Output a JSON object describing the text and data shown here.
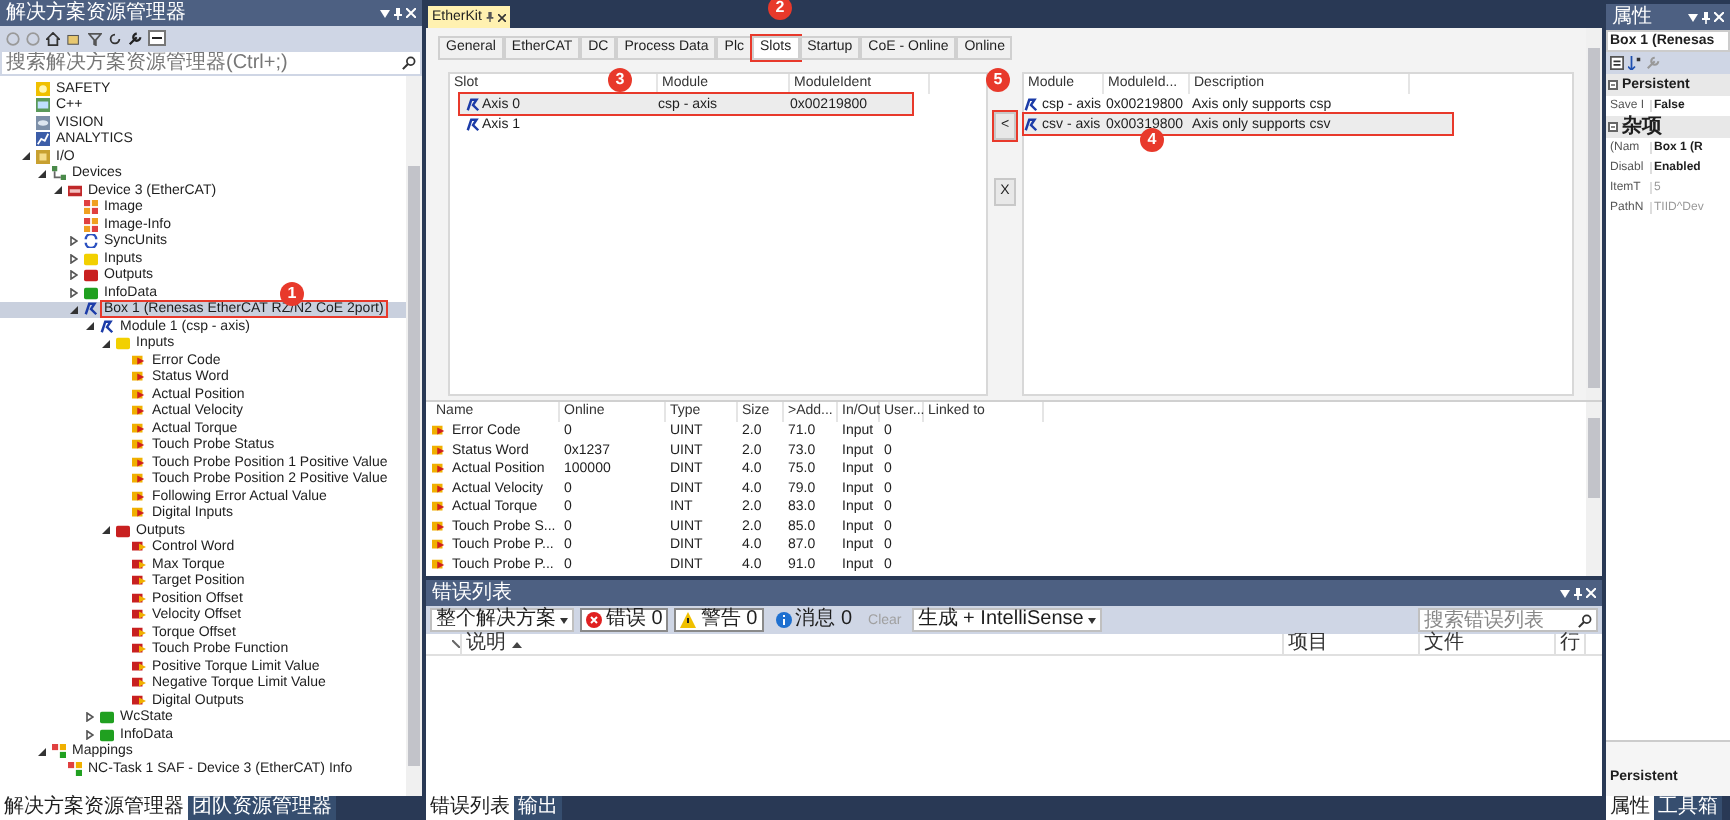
{
  "solution_explorer": {
    "title": "解决方案资源管理器",
    "search": {
      "placeholder": "搜索解决方案资源管理器(Ctrl+;)"
    },
    "tree": [
      {
        "label": "SAFETY",
        "kind": "safety",
        "selected": false
      },
      {
        "label": "C++",
        "kind": "cpp",
        "selected": false
      },
      {
        "label": "VISION",
        "kind": "vision",
        "selected": false
      },
      {
        "label": "ANALYTICS",
        "kind": "analytics",
        "selected": false
      },
      {
        "label": "I/O",
        "kind": "io",
        "selected": false,
        "expanded": true,
        "children": [
          {
            "label": "Devices",
            "kind": "devices",
            "selected": false,
            "expanded": true,
            "children": [
              {
                "label": "Device 3 (EtherCAT)",
                "kind": "device",
                "selected": false,
                "expanded": true,
                "children": [
                  {
                    "label": "Image",
                    "kind": "image",
                    "selected": false
                  },
                  {
                    "label": "Image-Info",
                    "kind": "image",
                    "selected": false
                  },
                  {
                    "label": "SyncUnits",
                    "kind": "sync",
                    "selected": false,
                    "expanded": false
                  },
                  {
                    "label": "Inputs",
                    "kind": "inputs",
                    "selected": false,
                    "expanded": false
                  },
                  {
                    "label": "Outputs",
                    "kind": "outputs",
                    "selected": false,
                    "expanded": false
                  },
                  {
                    "label": "InfoData",
                    "kind": "infodata",
                    "selected": false,
                    "expanded": false
                  },
                  {
                    "label": "Box 1 (Renesas EtherCAT RZ/N2 CoE 2port)",
                    "kind": "box",
                    "selected": true,
                    "expanded": true,
                    "callout": "1",
                    "children": [
                      {
                        "label": "Module 1 (csp - axis)",
                        "kind": "box",
                        "selected": false,
                        "expanded": true,
                        "children": [
                          {
                            "label": "Inputs",
                            "kind": "inputs",
                            "selected": false,
                            "expanded": true,
                            "children": [
                              {
                                "label": "Error Code",
                                "kind": "input-var",
                                "selected": false
                              },
                              {
                                "label": "Status Word",
                                "kind": "input-var",
                                "selected": false
                              },
                              {
                                "label": "Actual Position",
                                "kind": "input-var",
                                "selected": false
                              },
                              {
                                "label": "Actual Velocity",
                                "kind": "input-var",
                                "selected": false
                              },
                              {
                                "label": "Actual Torque",
                                "kind": "input-var",
                                "selected": false
                              },
                              {
                                "label": "Touch Probe Status",
                                "kind": "input-var",
                                "selected": false
                              },
                              {
                                "label": "Touch Probe Position 1 Positive Value",
                                "kind": "input-var",
                                "selected": false
                              },
                              {
                                "label": "Touch Probe Position 2 Positive Value",
                                "kind": "input-var",
                                "selected": false
                              },
                              {
                                "label": "Following Error Actual Value",
                                "kind": "input-var",
                                "selected": false
                              },
                              {
                                "label": "Digital Inputs",
                                "kind": "input-var",
                                "selected": false
                              }
                            ]
                          },
                          {
                            "label": "Outputs",
                            "kind": "outputs",
                            "selected": false,
                            "expanded": true,
                            "children": [
                              {
                                "label": "Control Word",
                                "kind": "output-var",
                                "selected": false
                              },
                              {
                                "label": "Max Torque",
                                "kind": "output-var",
                                "selected": false
                              },
                              {
                                "label": "Target Position",
                                "kind": "output-var",
                                "selected": false
                              },
                              {
                                "label": "Position Offset",
                                "kind": "output-var",
                                "selected": false
                              },
                              {
                                "label": "Velocity Offset",
                                "kind": "output-var",
                                "selected": false
                              },
                              {
                                "label": "Torque Offset",
                                "kind": "output-var",
                                "selected": false
                              },
                              {
                                "label": "Touch Probe Function",
                                "kind": "output-var",
                                "selected": false
                              },
                              {
                                "label": "Positive Torque Limit Value",
                                "kind": "output-var",
                                "selected": false
                              },
                              {
                                "label": "Negative Torque Limit Value",
                                "kind": "output-var",
                                "selected": false
                              },
                              {
                                "label": "Digital Outputs",
                                "kind": "output-var",
                                "selected": false
                              }
                            ]
                          }
                        ]
                      },
                      {
                        "label": "WcState",
                        "kind": "infodata",
                        "selected": false,
                        "expanded": false
                      },
                      {
                        "label": "InfoData",
                        "kind": "infodata",
                        "selected": false,
                        "expanded": false
                      }
                    ]
                  }
                ]
              }
            ]
          },
          {
            "label": "Mappings",
            "kind": "mappings",
            "selected": false,
            "expanded": true,
            "children": [
              {
                "label": "NC-Task 1 SAF - Device 3 (EtherCAT) Info",
                "kind": "mapping",
                "selected": false
              }
            ]
          }
        ]
      }
    ],
    "bottom_tabs": [
      {
        "label": "解决方案资源管理器",
        "selected": true
      },
      {
        "label": "团队资源管理器",
        "selected": false
      }
    ]
  },
  "document": {
    "tab": {
      "label": "EtherKit"
    },
    "tabs": [
      {
        "label": "General",
        "selected": false
      },
      {
        "label": "EtherCAT",
        "selected": false
      },
      {
        "label": "DC",
        "selected": false
      },
      {
        "label": "Process Data",
        "selected": false
      },
      {
        "label": "Plc",
        "selected": false
      },
      {
        "label": "Slots",
        "selected": true,
        "callout": "2"
      },
      {
        "label": "Startup",
        "selected": false
      },
      {
        "label": "CoE - Online",
        "selected": false
      },
      {
        "label": "Online",
        "selected": false
      }
    ],
    "slots": {
      "columns": [
        "Slot",
        "Module",
        "ModuleIdent"
      ],
      "rows": [
        {
          "cells": [
            "Axis 0",
            "csp - axis",
            "0x00219800"
          ],
          "selected": true,
          "callout": "3"
        },
        {
          "cells": [
            "Axis 1"
          ],
          "selected": false
        }
      ]
    },
    "buttons": [
      {
        "label": "<",
        "callout": "5"
      },
      {
        "label": "X"
      }
    ],
    "modules": {
      "columns": [
        "Module",
        "ModuleId...",
        "Description"
      ],
      "rows": [
        {
          "cells": [
            "csp - axis",
            "0x00219800",
            "Axis only supports csp"
          ],
          "selected": false
        },
        {
          "cells": [
            "csv - axis",
            "0x00319800",
            "Axis only supports csv"
          ],
          "selected": true,
          "callout": "4"
        }
      ]
    },
    "variables": {
      "columns": [
        "Name",
        "Online",
        "Type",
        "Size",
        ">Add...",
        "In/Out",
        "User...",
        "Linked to"
      ],
      "rows": [
        [
          "Error Code",
          "0",
          "UINT",
          "2.0",
          "71.0",
          "Input",
          "0"
        ],
        [
          "Status Word",
          "0x1237",
          "UINT",
          "2.0",
          "73.0",
          "Input",
          "0"
        ],
        [
          "Actual Position",
          "100000",
          "DINT",
          "4.0",
          "75.0",
          "Input",
          "0"
        ],
        [
          "Actual Velocity",
          "0",
          "DINT",
          "4.0",
          "79.0",
          "Input",
          "0"
        ],
        [
          "Actual Torque",
          "0",
          "INT",
          "2.0",
          "83.0",
          "Input",
          "0"
        ],
        [
          "Touch Probe S...",
          "0",
          "UINT",
          "2.0",
          "85.0",
          "Input",
          "0"
        ],
        [
          "Touch Probe P...",
          "0",
          "DINT",
          "4.0",
          "87.0",
          "Input",
          "0"
        ],
        [
          "Touch Probe P...",
          "0",
          "DINT",
          "4.0",
          "91.0",
          "Input",
          "0"
        ]
      ]
    }
  },
  "error_list": {
    "title": "错误列表",
    "scope": "整个解决方案",
    "filters": [
      {
        "kind": "error",
        "label": "错误 0",
        "on": true
      },
      {
        "kind": "warning",
        "label": "警告 0",
        "on": true
      },
      {
        "kind": "message",
        "label": "消息 0",
        "on": false
      }
    ],
    "clear": {
      "label": "Clear",
      "disabled": true
    },
    "source": "生成 + IntelliSense",
    "search": {
      "placeholder": "搜索错误列表"
    },
    "columns": [
      "说明",
      "项目",
      "文件",
      "行"
    ],
    "bottom_tabs": [
      {
        "label": "错误列表",
        "selected": true
      },
      {
        "label": "输出",
        "selected": false
      }
    ]
  },
  "properties": {
    "title": "属性",
    "object": "Box 1 (Renesas",
    "categories": [
      {
        "name": "Persistent",
        "expanded": true,
        "items": [
          {
            "name": "Save I",
            "value": "False",
            "readonly": false
          }
        ]
      },
      {
        "name": "杂项",
        "expanded": true,
        "items": [
          {
            "name": "(Nam",
            "value": "Box 1 (R",
            "readonly": false
          },
          {
            "name": "Disabl",
            "value": "Enabled",
            "readonly": false
          },
          {
            "name": "ItemT",
            "value": "5",
            "readonly": true
          },
          {
            "name": "PathN",
            "value": "TIID^Dev",
            "readonly": true
          }
        ]
      }
    ],
    "description": "Persistent",
    "bottom_tabs": [
      {
        "label": "属性",
        "selected": true
      },
      {
        "label": "工具箱",
        "selected": false
      }
    ]
  }
}
